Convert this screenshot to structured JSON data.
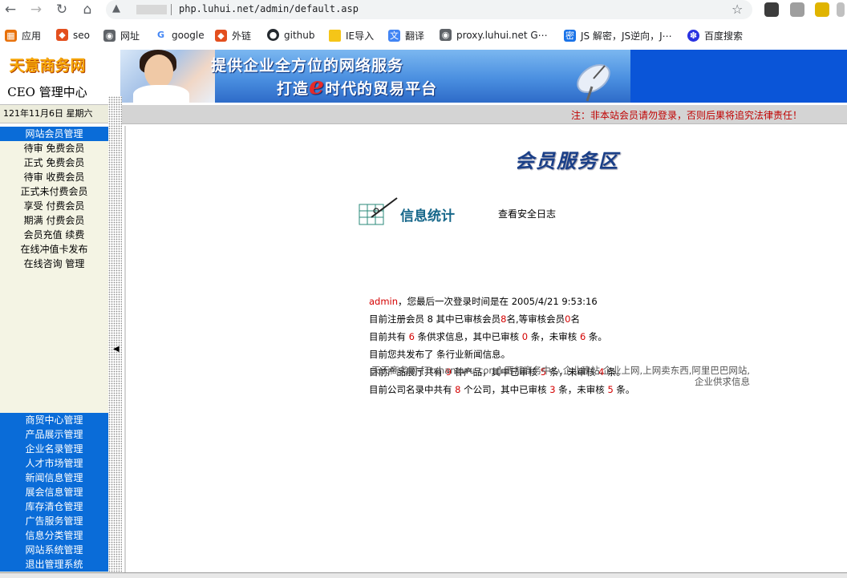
{
  "browser": {
    "url": "php.luhui.net/admin/default.asp",
    "bookmarks": [
      {
        "label": "应用",
        "icon": "apps-grid-icon"
      },
      {
        "label": "seo",
        "icon": "diamond-icon"
      },
      {
        "label": "网址",
        "icon": "globe-icon"
      },
      {
        "label": "google",
        "icon": "google-icon"
      },
      {
        "label": "外链",
        "icon": "diamond-icon"
      },
      {
        "label": "github",
        "icon": "github-icon"
      },
      {
        "label": "IE导入",
        "icon": "folder-icon"
      },
      {
        "label": "翻译",
        "icon": "translate-icon"
      },
      {
        "label": "proxy.luhui.net G⋯",
        "icon": "globe-icon"
      },
      {
        "label": "JS 解密，JS逆向，J⋯",
        "icon": "bracket-icon"
      },
      {
        "label": "百度搜索",
        "icon": "baidu-icon"
      }
    ]
  },
  "logo": {
    "title": "天意商务网",
    "subtitle": "CEO 管理中心"
  },
  "date": "121年11月6日 星期六",
  "banner": {
    "line1": "提供企业全方位的网络服务",
    "line2_a": "打造",
    "line2_e": "e",
    "line2_b": "时代的贸易平台"
  },
  "notice": "注：非本站会员请勿登录，否则后果将追究法律责任！",
  "sidebar": {
    "member_header": "网站会员管理",
    "member_items": [
      "待审 免费会员",
      "正式 免费会员",
      "待审 收费会员",
      "正式未付费会员",
      "享受 付费会员",
      "期满 付费会员",
      "会员充值 续费",
      "在线冲值卡发布",
      "在线咨询 管理"
    ],
    "blue_items": [
      "商贸中心管理",
      "产品展示管理",
      "企业名录管理",
      "人才市场管理",
      "新闻信息管理",
      "展会信息管理",
      "库存清仓管理",
      "广告服务管理",
      "信息分类管理",
      "网站系统管理",
      "退出管理系统"
    ]
  },
  "main": {
    "service_title": "会员服务区",
    "stat_title": "信息统计",
    "log_link": "查看安全日志",
    "admin_name": "admin",
    "login_text": "，您最后一次登录时间是在",
    "login_time": "2005/4/21 9:53:16",
    "line2": {
      "a": "目前注册会员",
      "total": "8",
      "b": "其中已审核会员",
      "approved": "8",
      "c": "名,等审核会员",
      "pending": "0",
      "d": "名"
    },
    "line3": {
      "a": "目前共有",
      "total": "6",
      "b": "条供求信息，其中已审核",
      "approved": "0",
      "c": "条，未审核",
      "pending": "6",
      "d": "条。"
    },
    "line4": "目前您共发布了 条行业新闻信息。",
    "line5": {
      "a": "目前产品展厅共有",
      "total": "9",
      "b": "种产品，其中已审核",
      "approved": "5",
      "c": "条，未审核",
      "pending": "4",
      "d": "条。"
    },
    "line6": {
      "a": "目前公司名录中共有",
      "total": "8",
      "b": "个公司，其中已审核",
      "approved": "3",
      "c": "条，未审核",
      "pending": "5",
      "d": "条。"
    },
    "footer": "天天商务网-[Ttshangwu.com]-西部商务中心,企业建站,企业上网,上网卖东西,阿里巴巴网站,企业供求信息"
  }
}
